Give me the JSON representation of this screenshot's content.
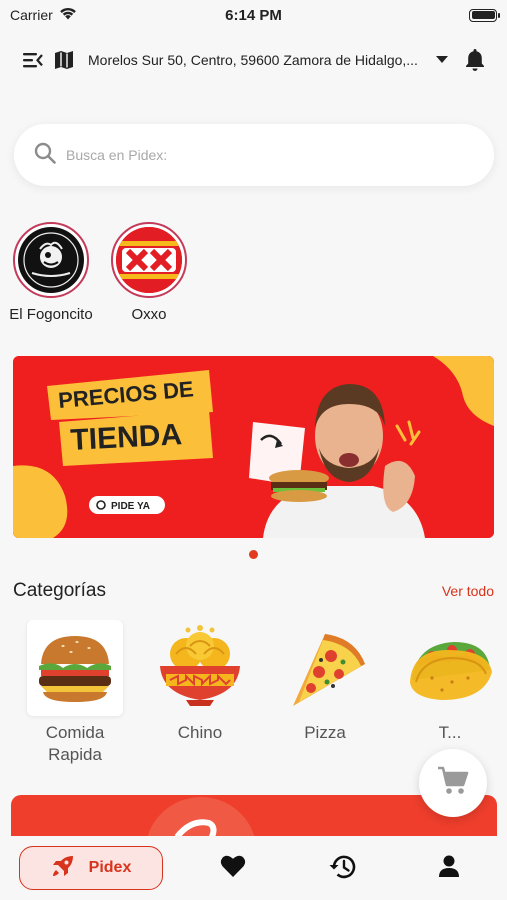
{
  "status_bar": {
    "carrier": "Carrier",
    "time": "6:14 PM",
    "battery_level": 1.0
  },
  "header": {
    "address": "Morelos Sur 50, Centro, 59600 Zamora de Hidalgo,...",
    "icons": [
      "menu-icon",
      "map-icon",
      "caret-down-icon",
      "bell-icon"
    ]
  },
  "search": {
    "placeholder": "Busca en Pidex:",
    "value": ""
  },
  "stores": [
    {
      "name": "El Fogoncito",
      "logo": "fogoncito-logo"
    },
    {
      "name": "Oxxo",
      "logo": "oxxo-logo"
    }
  ],
  "banner": {
    "headline_1": "PRECIOS DE",
    "headline_2": "TIENDA",
    "cta": "PIDE YA",
    "colors": {
      "background": "#ef1f1f",
      "accent": "#fbbf3a"
    },
    "active_slide": 1,
    "slide_count": 1
  },
  "categories": {
    "title": "Categorías",
    "see_all": "Ver todo",
    "items": [
      {
        "label": "Comida Rapida",
        "icon": "burger-icon"
      },
      {
        "label": "Chino",
        "icon": "noodles-icon"
      },
      {
        "label": "Pizza",
        "icon": "pizza-icon"
      },
      {
        "label": "T...",
        "icon": "taco-icon"
      }
    ]
  },
  "tabbar": {
    "active_label": "Pidex",
    "tabs": [
      "rocket-icon",
      "heart-icon",
      "history-icon",
      "user-icon"
    ]
  },
  "colors": {
    "brand": "#d8331c",
    "brand_light": "#fbe4e2",
    "card": "#ef3e2c"
  }
}
